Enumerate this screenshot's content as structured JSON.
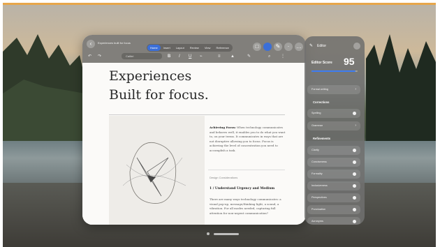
{
  "window": {
    "doc_title": "Experiences built for focus",
    "tabs": [
      "Home",
      "Insert",
      "Layout",
      "Review",
      "View",
      "Reference"
    ],
    "active_tab": "Home",
    "font_field": "Calibri",
    "heading_line1": "Experiences",
    "heading_line2": "Built for focus.",
    "aside_bold": "Achieving Focus:",
    "aside_text": "When technology communicates and behaves well, it enables you to do what you want to, on your terms. It communicates in ways that are not disruptive allowing you to focus. Focus is achieving the level of concentration you need to accomplish a task.",
    "section_label": "Design Considerations",
    "subhead": "1 / Understand Urgency and Medium",
    "body2": "There are many ways technology communicates: a visual pop-up, message/thinking light, a sound, a vibration. For all modes needed, capturing full attention for non-urgent communication?"
  },
  "editor": {
    "title": "Editor",
    "score_label": "Editor Score",
    "score_value": "95",
    "score_fraction": 0.95,
    "formal_writing": "Formal writing",
    "corrections_heading": "Corrections",
    "corrections": [
      "Spelling",
      "Grammar"
    ],
    "refinements_heading": "Refinements",
    "refinements": [
      "Clarity",
      "Conciseness",
      "Formality",
      "Inclusiveness",
      "Perspectives",
      "Punctuation",
      "Acronyms"
    ],
    "accent_color": "#3e7cf2"
  }
}
